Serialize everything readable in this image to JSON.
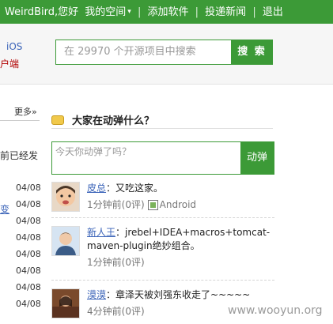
{
  "topbar": {
    "username": "WeirdBird",
    "greeting": ",您好",
    "my_space": "我的空间",
    "caret": "▾",
    "separator": "|",
    "add_software": "添加软件",
    "submit_news": "投递新闻",
    "logout": "退出"
  },
  "header": {
    "ios_label": "iOS",
    "client_label": "户端",
    "search_placeholder": "在 29970 个开源项目中搜索",
    "search_button": "搜 索"
  },
  "left": {
    "more": "更多»",
    "truncated_text": "前已经发",
    "truncated_link": "变",
    "dates": [
      "04/08",
      "04/08",
      "04/08",
      "04/08",
      "04/08",
      "04/08",
      "04/08",
      "04/08"
    ]
  },
  "tweets": {
    "title": "大家在动弹什么？",
    "input_placeholder": "今天你动弹了吗？",
    "post_button": "动弹",
    "items": [
      {
        "user": "皮总",
        "text": "：又吃这家。",
        "time": "1分钟前(0评)",
        "client": "Android"
      },
      {
        "user": "新人王",
        "text": "：jrebel+IDEA+macros+tomcat-maven-plugin绝妙组合。",
        "time": "1分钟前(0评)",
        "client": ""
      },
      {
        "user": "漠漠",
        "text": "：章泽天被刘强东收走了~~~~~",
        "time": "4分钟前(0评)",
        "client": ""
      }
    ]
  },
  "watermark": "www.wooyun.org",
  "colors": {
    "brand_green": "#3c9a37",
    "link_blue": "#3a63b8"
  }
}
